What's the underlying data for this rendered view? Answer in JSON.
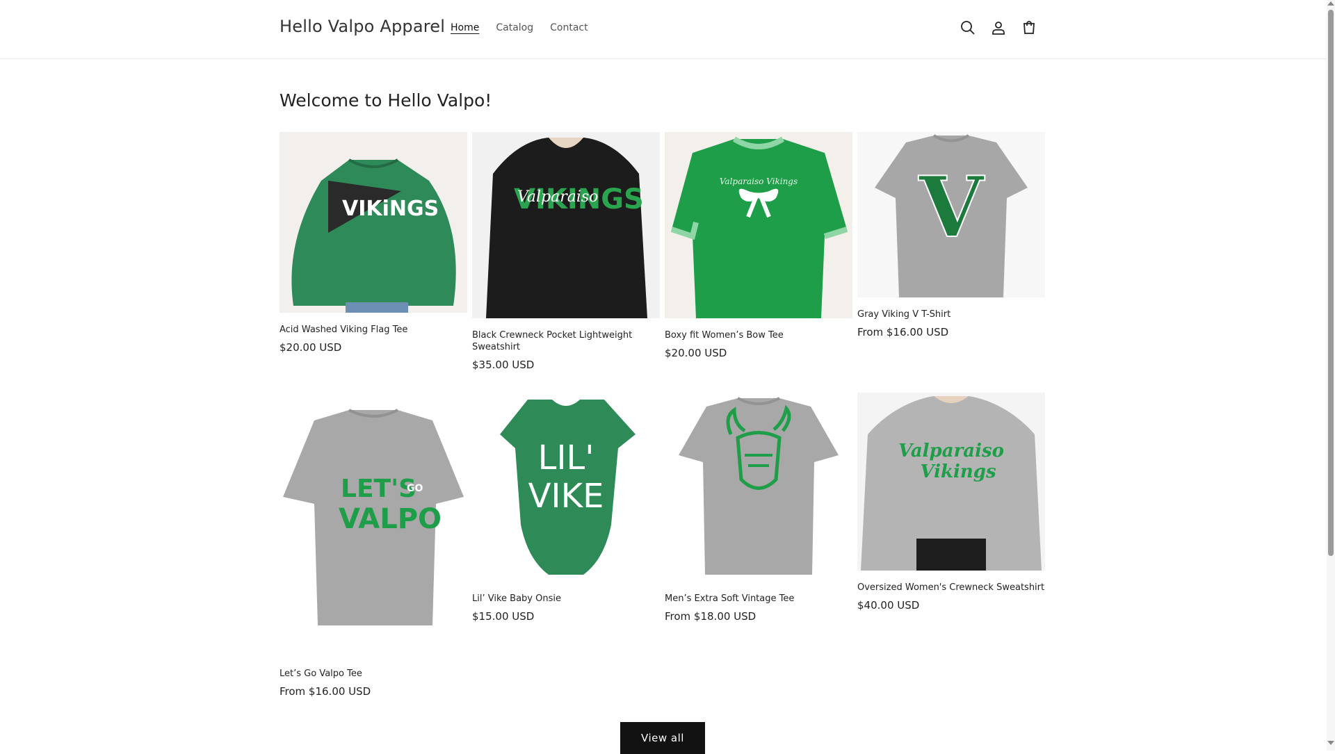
{
  "header": {
    "brand": "Hello Valpo Apparel",
    "nav": [
      "Home",
      "Catalog",
      "Contact"
    ],
    "active_nav": "Home",
    "icons": [
      "search-icon",
      "account-icon",
      "cart-icon"
    ]
  },
  "main": {
    "heading": "Welcome to Hello Valpo!",
    "products": [
      {
        "title": "Acid Washed Viking Flag Tee",
        "price": "$20.00 USD"
      },
      {
        "title": "Black Crewneck Pocket Lightweight Sweatshirt",
        "price": "$35.00 USD"
      },
      {
        "title": "Boxy fit Women’s Bow Tee",
        "price": "$20.00 USD"
      },
      {
        "title": "Gray Viking V T-Shirt",
        "price": "From $16.00 USD"
      },
      {
        "title": "Let’s Go Valpo Tee",
        "price": "From $16.00 USD"
      },
      {
        "title": "Lil’ Vike Baby Onsie",
        "price": "$15.00 USD"
      },
      {
        "title": "Men’s Extra Soft Vintage Tee",
        "price": "From $18.00 USD"
      },
      {
        "title": "Oversized Women's Crewneck Sweatshirt",
        "price": "$40.00 USD"
      }
    ],
    "image_text": {
      "p1": "VIKiNGS",
      "p2_main": "VIKINGS",
      "p2_script": "Valparaiso",
      "p3": "Valparaiso Vikings",
      "p4": "V",
      "p5_top": "LET'S",
      "p5_go": "GO",
      "p5_bottom": "VALPO",
      "p6_top": "LIL'",
      "p6_bottom": "VIKE",
      "p8_top": "Valparaiso",
      "p8_bottom": "Vikings"
    },
    "view_all": "View all"
  },
  "colors": {
    "accent_green": "#1f9e4a",
    "heather_green": "#2f8a5a",
    "heather_gray": "#a7a7a7",
    "button_black": "#121212"
  }
}
